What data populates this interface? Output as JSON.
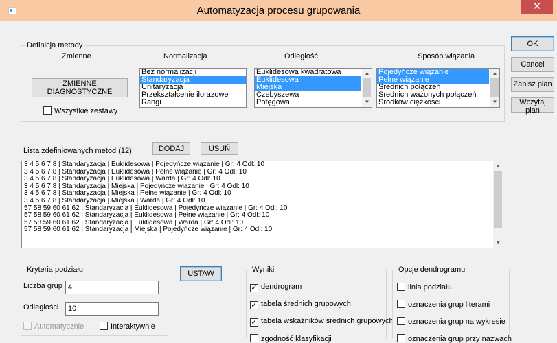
{
  "window": {
    "title": "Automatyzacja procesu grupowania",
    "close_glyph": "✕"
  },
  "buttons": {
    "ok": "OK",
    "cancel": "Cancel",
    "save_plan": "Zapisz plan",
    "load_plan": "Wczytaj plan",
    "add": "DODAJ",
    "remove": "USUŃ",
    "set": "USTAW"
  },
  "method_def": {
    "legend": "Definicja metody",
    "variables_header": "Zmienne",
    "normalization_header": "Normalizacja",
    "distance_header": "Odległość",
    "linkage_header": "Sposób wiązania",
    "variables_button": "ZMIENNE DIAGNOSTYCZNE",
    "all_sets_label": "Wszystkie zestawy",
    "all_sets_checked": false,
    "normalization": [
      {
        "label": "Bez normalizacji",
        "selected": false
      },
      {
        "label": "Standaryzacja",
        "selected": true
      },
      {
        "label": "Unitaryzacja",
        "selected": false
      },
      {
        "label": "Przekształcenie ilorazowe",
        "selected": false
      },
      {
        "label": "Rangi",
        "selected": false
      }
    ],
    "distance": [
      {
        "label": "Euklidesowa kwadratowa",
        "selected": false
      },
      {
        "label": "Euklidesowa",
        "selected": true
      },
      {
        "label": "Miejska",
        "selected": true
      },
      {
        "label": "Czebyszewa",
        "selected": false
      },
      {
        "label": "Potęgowa",
        "selected": false
      }
    ],
    "linkage": [
      {
        "label": "Pojedyńcze wiązanie",
        "selected": true
      },
      {
        "label": "Pełne wiązanie",
        "selected": true
      },
      {
        "label": "Średnich połączeń",
        "selected": false
      },
      {
        "label": "Średnich ważonych połączeń",
        "selected": false
      },
      {
        "label": "Środków ciężkości",
        "selected": false
      }
    ]
  },
  "methods_list": {
    "label": "Lista zdefiniowanych metod (12)",
    "items": [
      "3 4 5 6 7 8  |  Standaryzacja  |  Euklidesowa  |  Pojedyńcze wiązanie | Gr: 4  Odl: 10",
      "3 4 5 6 7 8  |  Standaryzacja  |  Euklidesowa  |  Pełne wiązanie | Gr: 4  Odl: 10",
      "3 4 5 6 7 8  |  Standaryzacja  |  Euklidesowa  |  Warda | Gr: 4  Odl: 10",
      "3 4 5 6 7 8  |  Standaryzacja  |  Miejska  |  Pojedyńcze wiązanie | Gr: 4  Odl: 10",
      "3 4 5 6 7 8  |  Standaryzacja  |  Miejska  |  Pełne wiązanie | Gr: 4  Odl: 10",
      "3 4 5 6 7 8  |  Standaryzacja  |  Miejska  |  Warda | Gr: 4  Odl: 10",
      "57 58 59 60 61 62  |  Standaryzacja  |  Euklidesowa  |  Pojedyńcze wiązanie | Gr: 4  Odl: 10",
      "57 58 59 60 61 62  |  Standaryzacja  |  Euklidesowa  |  Pełne wiązanie | Gr: 4  Odl: 10",
      "57 58 59 60 61 62  |  Standaryzacja  |  Euklidesowa  |  Warda | Gr: 4  Odl: 10",
      "57 58 59 60 61 62  |  Standaryzacja  |  Miejska  |  Pojedyńcze wiązanie | Gr: 4  Odl: 10"
    ]
  },
  "criteria": {
    "legend": "Kryteria podziału",
    "groups_label": "Liczba grup",
    "groups_value": "4",
    "distances_label": "Odległości",
    "distances_value": "10",
    "auto_label": "Automatycznie",
    "auto_checked": false,
    "auto_disabled": true,
    "interactive_label": "Interaktywnie",
    "interactive_checked": false
  },
  "results": {
    "legend": "Wyniki",
    "items": [
      {
        "label": "dendrogram",
        "checked": true
      },
      {
        "label": "tabela średnich grupowych",
        "checked": true
      },
      {
        "label": "tabela wskaźników średnich grupowych",
        "checked": true
      },
      {
        "label": "zgodność klasyfikacji",
        "checked": false
      }
    ]
  },
  "dendro_options": {
    "legend": "Opcje dendrogramu",
    "items": [
      {
        "label": "linia podziału",
        "checked": false
      },
      {
        "label": "oznaczenia grup literami",
        "checked": false
      },
      {
        "label": "oznaczenia grup na wykresie",
        "checked": false
      },
      {
        "label": "oznaczenia grup przy nazwach",
        "checked": false
      }
    ]
  },
  "glyphs": {
    "check": "✓",
    "scroll_up": "▲",
    "scroll_down": "▼"
  }
}
